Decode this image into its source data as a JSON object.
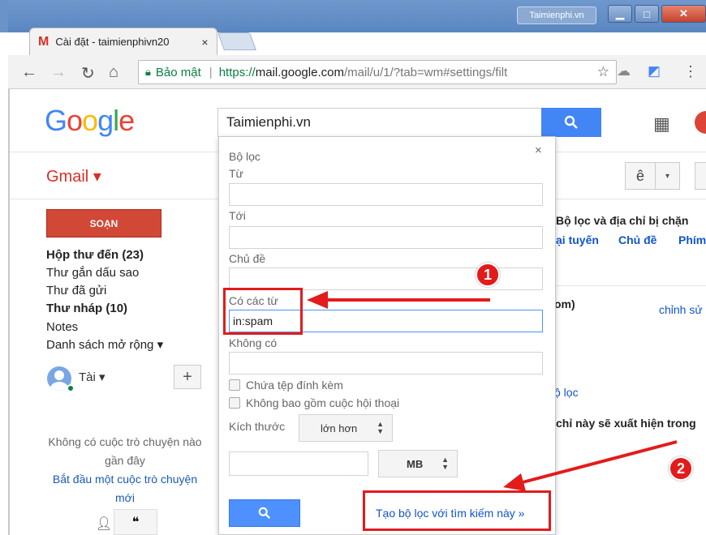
{
  "browser": {
    "tab_title": "Cài đặt - taimienphivn20",
    "tab_close": "×",
    "watermark": "Taimienphi.vn",
    "window_min": "▁",
    "window_max": "□",
    "window_close": "✕",
    "address": {
      "secure_label": "Bảo mật",
      "url_proto": "https://",
      "url_host": "mail.google.com",
      "url_rest": "/mail/u/1/?tab=wm#settings/filt"
    }
  },
  "gmail": {
    "logo": [
      "G",
      "o",
      "o",
      "g",
      "l",
      "e"
    ],
    "logo_colors": [
      "#4285f4",
      "#ea4335",
      "#fbbc05",
      "#4285f4",
      "#34a853",
      "#ea4335"
    ],
    "app_label": "Gmail ▾",
    "compose_label": "SOẠN",
    "nav": {
      "inbox": "Hộp thư đến (23)",
      "starred": "Thư gắn dấu sao",
      "sent": "Thư đã gửi",
      "drafts": "Thư nháp (10)",
      "notes": "Notes",
      "more": "Danh sách mở rộng ▾"
    },
    "user_name": "Tài ▾",
    "add_chat": "+",
    "chat_empty": "Không có cuộc trò chuyện nào gần đây",
    "chat_start": "Bắt đầu một cuộc trò chuyện mới"
  },
  "search": {
    "value": "Taimienphi.vn"
  },
  "filter_popup": {
    "close": "×",
    "header": "Bộ lọc",
    "from_label": "Từ",
    "to_label": "Tới",
    "subject_label": "Chủ đề",
    "has_words_label": "Có các từ",
    "has_words_value": "in:spam",
    "doesnt_have_label": "Không có",
    "has_attachment_label": "Chứa tệp đính kèm",
    "no_chats_label": "Không bao gồm cuộc hội thoại",
    "size_label": "Kích thước",
    "size_op": "lớn hơn",
    "size_unit": "MB",
    "create_filter_link": "Tạo bộ lọc với tìm kiếm này »"
  },
  "settings_bg": {
    "lang_button": "ê",
    "filters_heading": "Bộ lọc và địa chỉ bị chặn",
    "tab_online": "ại tuyến",
    "tab_themes": "Chủ đề",
    "tab_shortcuts": "Phím",
    "row_text": "om)",
    "row_edit": "chỉnh sử",
    "create_link": "ộ lọc",
    "blocked_text": "chỉ này sẽ xuất hiện trong"
  },
  "annotations": {
    "badge_1": "1",
    "badge_2": "2",
    "color": "#e31b1b"
  }
}
